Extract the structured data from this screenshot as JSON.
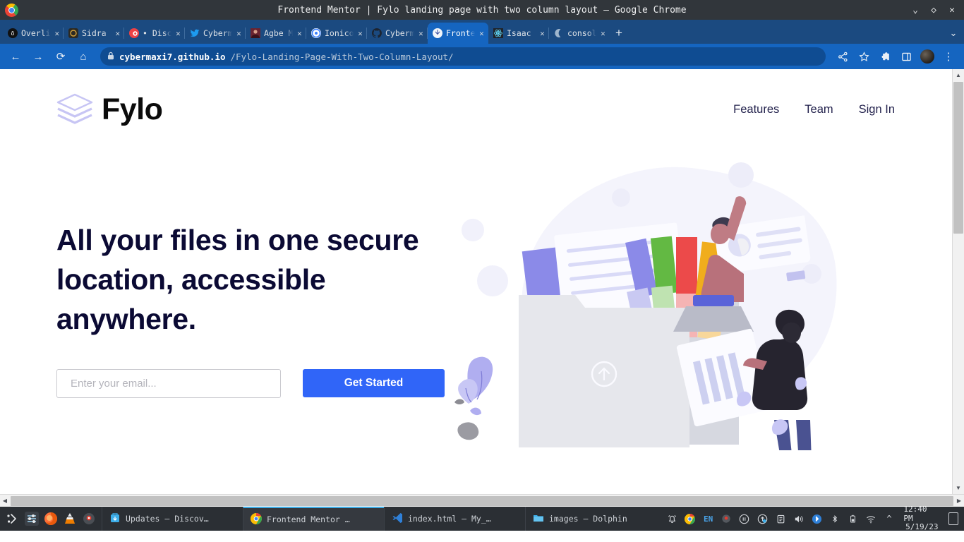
{
  "window": {
    "title": "Frontend Mentor | Fylo landing page with two column layout – Google Chrome",
    "minimize": "⌄",
    "maximize": "◇",
    "close": "✕"
  },
  "tabs": [
    {
      "label": "Overline",
      "close": "✕",
      "favicon": "overline-icon"
    },
    {
      "label": "Sidra Cl",
      "close": "✕",
      "favicon": "sidra-icon"
    },
    {
      "label": "• Disco",
      "close": "✕",
      "favicon": "discord-icon"
    },
    {
      "label": "Cyberma",
      "close": "✕",
      "favicon": "twitter-icon"
    },
    {
      "label": "Agbe Mo",
      "close": "✕",
      "favicon": "person-icon"
    },
    {
      "label": "Ionicon",
      "close": "✕",
      "favicon": "ionicons-icon"
    },
    {
      "label": "Cyberma",
      "close": "✕",
      "favicon": "github-icon"
    },
    {
      "label": "Fronten",
      "close": "✕",
      "favicon": "frontendmentor-icon"
    },
    {
      "label": "Isaac I",
      "close": "✕",
      "favicon": "react-icon"
    },
    {
      "label": "console",
      "close": "✕",
      "favicon": "moon-icon"
    }
  ],
  "tabstrip": {
    "new_tab": "+",
    "tab_list": "⌄"
  },
  "toolbar": {
    "back": "←",
    "forward": "→",
    "reload": "⟳",
    "home": "⌂",
    "lock": "🔒",
    "url_host": "cybermaxi7.github.io",
    "url_path": "/Fylo-Landing-Page-With-Two-Column-Layout/",
    "share": "share-icon",
    "bookmark": "★",
    "extensions": "puzzle-icon",
    "sidepanel": "panel-icon",
    "profile": "avatar",
    "menu": "⋮"
  },
  "site": {
    "logo_text": "Fylo",
    "nav": [
      {
        "label": "Features"
      },
      {
        "label": "Team"
      },
      {
        "label": "Sign In"
      }
    ],
    "hero": {
      "title": "All your files in one secure location, accessible anywhere.",
      "email_placeholder": "Enter your email...",
      "email_value": "",
      "cta_label": "Get Started"
    },
    "colors": {
      "accent_blue": "#3065f8",
      "headline_navy": "#0b0a34",
      "nav_navy": "#22214c",
      "logo_lavender": "#c7c5f4",
      "blob_bg": "#f4f4fc"
    }
  },
  "taskbar": {
    "launchers": [
      {
        "name": "app-menu-icon"
      },
      {
        "name": "settings-icon"
      },
      {
        "name": "firefox-icon"
      },
      {
        "name": "vlc-icon"
      },
      {
        "name": "recorder-icon"
      }
    ],
    "tasks": [
      {
        "label": "Updates — Discov…",
        "icon": "discover-icon",
        "active": false
      },
      {
        "label": "Frontend Mentor …",
        "icon": "chrome-icon",
        "active": true
      },
      {
        "label": "index.html — My_…",
        "icon": "vscode-icon",
        "active": false
      },
      {
        "label": "images — Dolphin",
        "icon": "dolphin-icon",
        "active": false
      }
    ],
    "tray": [
      {
        "name": "notifications-icon",
        "glyph": "🔔"
      },
      {
        "name": "chrome-tray-icon",
        "glyph": ""
      },
      {
        "name": "keyboard-layout",
        "glyph": "EN"
      },
      {
        "name": "recorder-tray-icon",
        "glyph": ""
      },
      {
        "name": "media-pause-icon",
        "glyph": "⏸"
      },
      {
        "name": "updates-icon",
        "glyph": "↑"
      },
      {
        "name": "clipboard-icon",
        "glyph": "📋"
      },
      {
        "name": "volume-icon",
        "glyph": "🔊"
      },
      {
        "name": "bluetooth-active-icon",
        "glyph": ""
      },
      {
        "name": "bluetooth-icon",
        "glyph": ""
      },
      {
        "name": "battery-icon",
        "glyph": ""
      },
      {
        "name": "wifi-icon",
        "glyph": ""
      },
      {
        "name": "show-hidden-icon",
        "glyph": "^"
      }
    ],
    "clock": {
      "time": "12:40 PM",
      "date": "5/19/23"
    }
  }
}
